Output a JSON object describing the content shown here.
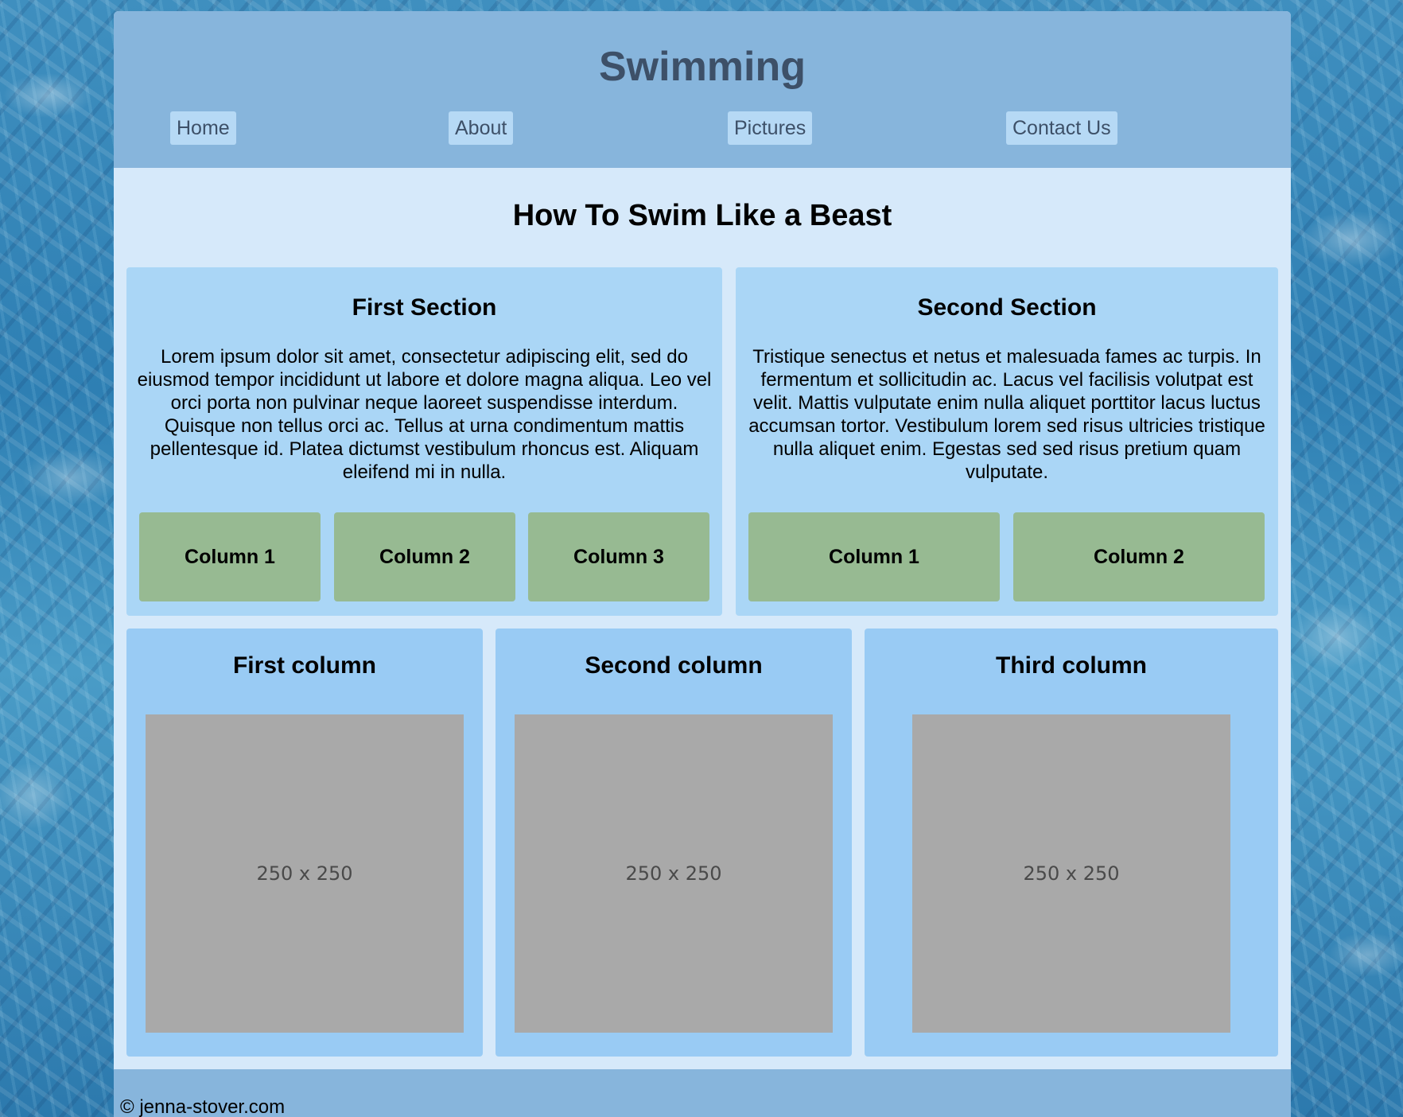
{
  "header": {
    "title": "Swimming",
    "nav": [
      "Home",
      "About",
      "Pictures",
      "Contact Us"
    ]
  },
  "main": {
    "heading": "How To Swim Like a Beast",
    "sections": [
      {
        "title": "First Section",
        "text": "Lorem ipsum dolor sit amet, consectetur adipiscing elit, sed do eiusmod tempor incididunt ut labore et dolore magna aliqua. Leo vel orci porta non pulvinar neque laoreet suspendisse interdum. Quisque non tellus orci ac. Tellus at urna condimentum mattis pellentesque id. Platea dictumst vestibulum rhoncus est. Aliquam eleifend mi in nulla.",
        "columns": [
          "Column 1",
          "Column 2",
          "Column 3"
        ]
      },
      {
        "title": "Second Section",
        "text": "Tristique senectus et netus et malesuada fames ac turpis. In fermentum et sollicitudin ac. Lacus vel facilisis volutpat est velit. Mattis vulputate enim nulla aliquet porttitor lacus luctus accumsan tortor. Vestibulum lorem sed risus ultricies tristique nulla aliquet enim. Egestas sed sed risus pretium quam vulputate.",
        "columns": [
          "Column 1",
          "Column 2"
        ]
      }
    ],
    "cards": [
      {
        "title": "First column",
        "image_label": "250 x 250"
      },
      {
        "title": "Second column",
        "image_label": "250 x 250"
      },
      {
        "title": "Third column",
        "image_label": "250 x 250"
      }
    ]
  },
  "footer": {
    "text": "© jenna-stover.com"
  },
  "colors": {
    "header_bg": "#87b5dc",
    "page_bg": "#d6e9fa",
    "section_bg": "#aad6f6",
    "column_bg": "#97ba92",
    "card_bg": "#99cbf4",
    "placeholder_bg": "#a9a9a9",
    "title_color": "#3d5068"
  }
}
